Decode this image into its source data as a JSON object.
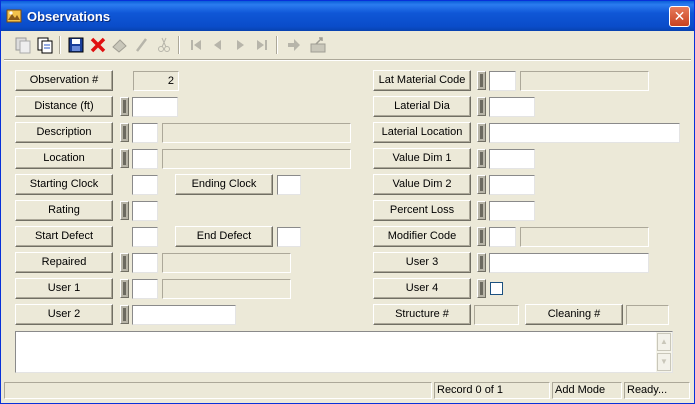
{
  "window": {
    "title": "Observations",
    "close_glyph": "✕"
  },
  "toolbar": {
    "buttons": [
      "copy-record-icon",
      "copy-icon",
      "save-icon",
      "delete-icon",
      "eraser-icon",
      "pencil-icon",
      "cut-icon",
      "first-record-icon",
      "previous-record-icon",
      "next-record-icon",
      "last-record-icon",
      "go-to-icon",
      "export-icon"
    ]
  },
  "form": {
    "observation_no": {
      "label": "Observation #",
      "value": "2"
    },
    "distance": {
      "label": "Distance (ft)",
      "value": ""
    },
    "description": {
      "label": "Description",
      "code": "",
      "text": ""
    },
    "location": {
      "label": "Location",
      "code": "",
      "text": ""
    },
    "starting_clock": {
      "label": "Starting Clock",
      "value": ""
    },
    "ending_clock": {
      "label": "Ending Clock",
      "value": ""
    },
    "rating": {
      "label": "Rating",
      "value": ""
    },
    "start_defect": {
      "label": "Start Defect",
      "value": ""
    },
    "end_defect": {
      "label": "End Defect",
      "value": ""
    },
    "repaired": {
      "label": "Repaired",
      "code": "",
      "text": ""
    },
    "user1": {
      "label": "User 1",
      "code": "",
      "text": ""
    },
    "user2": {
      "label": "User 2",
      "value": ""
    },
    "lat_material_code": {
      "label": "Lat Material Code",
      "code": "",
      "text": ""
    },
    "laterial_dia": {
      "label": "Laterial Dia",
      "value": ""
    },
    "laterial_location": {
      "label": "Laterial Location",
      "value": ""
    },
    "value_dim1": {
      "label": "Value Dim 1",
      "value": ""
    },
    "value_dim2": {
      "label": "Value Dim 2",
      "value": ""
    },
    "percent_loss": {
      "label": "Percent Loss",
      "value": ""
    },
    "modifier_code": {
      "label": "Modifier Code",
      "code": "",
      "text": ""
    },
    "user3": {
      "label": "User 3",
      "value": ""
    },
    "user4": {
      "label": "User 4",
      "checked": false
    },
    "structure_no": {
      "label": "Structure #",
      "value": ""
    },
    "cleaning_no": {
      "label": "Cleaning #",
      "value": ""
    },
    "comments": ""
  },
  "status": {
    "record": "Record 0 of 1",
    "mode": "Add Mode",
    "state": "Ready..."
  }
}
